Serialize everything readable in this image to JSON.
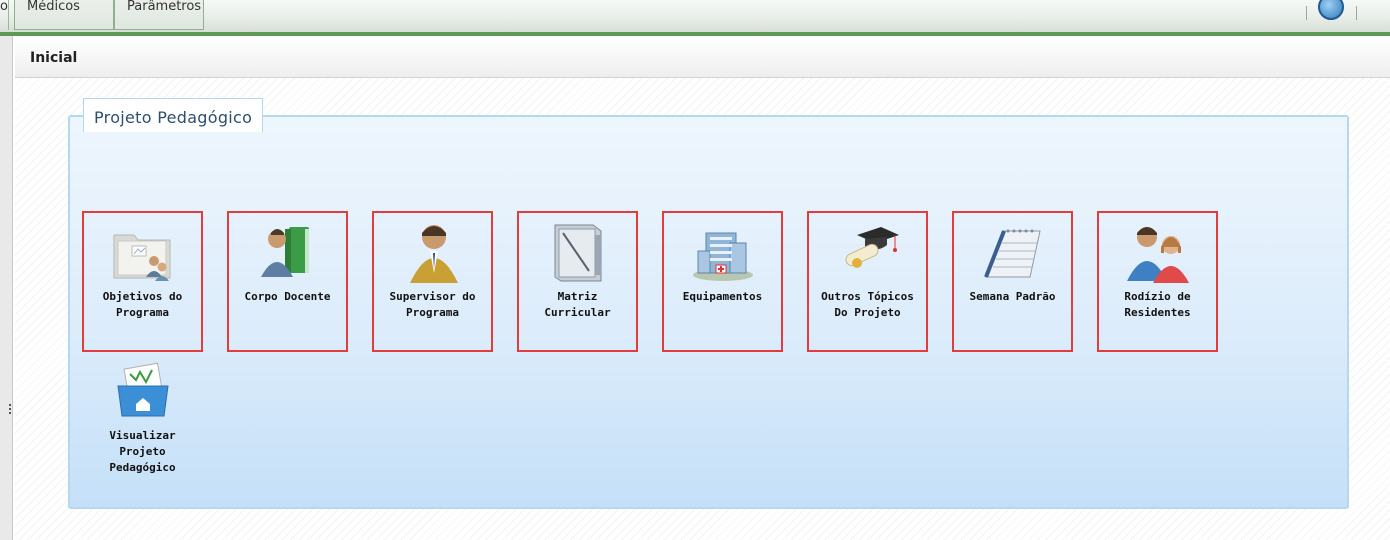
{
  "menu": {
    "partial_left": "o",
    "tabs": [
      {
        "label": "Médicos"
      },
      {
        "label": "Parâmetros"
      }
    ]
  },
  "breadcrumb": {
    "label": "Inicial"
  },
  "panel": {
    "legend": "Projeto Pedagógico",
    "tiles": [
      {
        "label": "Objetivos do\nPrograma",
        "icon": "folder-chart-users-icon"
      },
      {
        "label": "Corpo Docente",
        "icon": "teacher-book-icon"
      },
      {
        "label": "Supervisor do\nPrograma",
        "icon": "supervisor-person-icon"
      },
      {
        "label": "Matriz\nCurricular",
        "icon": "notebook-icon"
      },
      {
        "label": "Equipamentos",
        "icon": "hospital-building-icon"
      },
      {
        "label": "Outros Tópicos\nDo Projeto",
        "icon": "graduation-diploma-icon"
      },
      {
        "label": "Semana Padrão",
        "icon": "calendar-icon"
      },
      {
        "label": "Rodízio de\nResidentes",
        "icon": "residents-couple-icon"
      },
      {
        "label": "Visualizar\nProjeto\nPedagógico",
        "icon": "folder-home-icon"
      }
    ]
  },
  "colors": {
    "menu_accent": "#5b9b54",
    "tile_highlight": "#e23c3c",
    "panel_border": "#b5d8ec",
    "legend_text": "#2d4f6d"
  }
}
